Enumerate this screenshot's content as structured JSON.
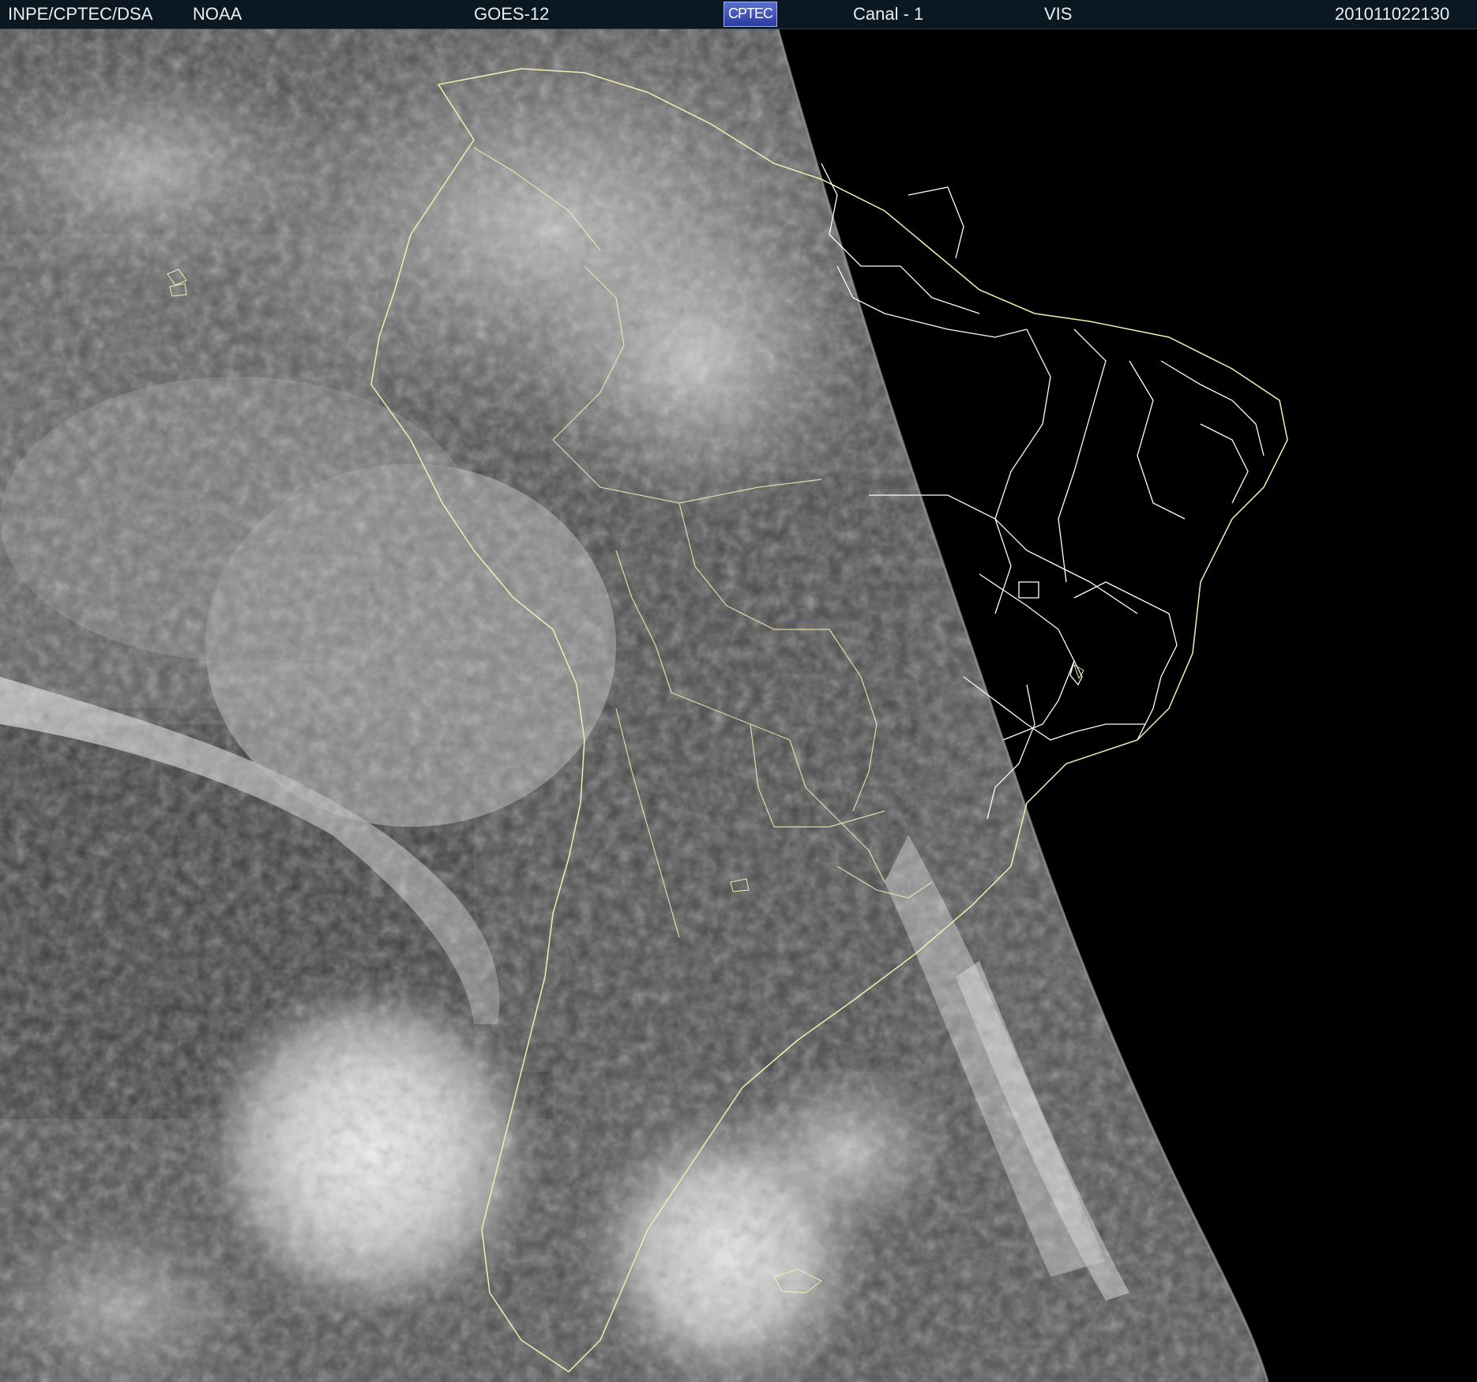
{
  "header": {
    "source": "INPE/CPTEC/DSA",
    "agency": "NOAA",
    "satellite": "GOES-12",
    "logo_text": "CPTEC",
    "channel": "Canal - 1",
    "band": "VIS",
    "timestamp": "201011022130"
  },
  "colors": {
    "header_bg": "#0b1822",
    "night_side": "#000000",
    "border_lines": "#f2f0b0",
    "brazil_borders": "#ffffff"
  }
}
